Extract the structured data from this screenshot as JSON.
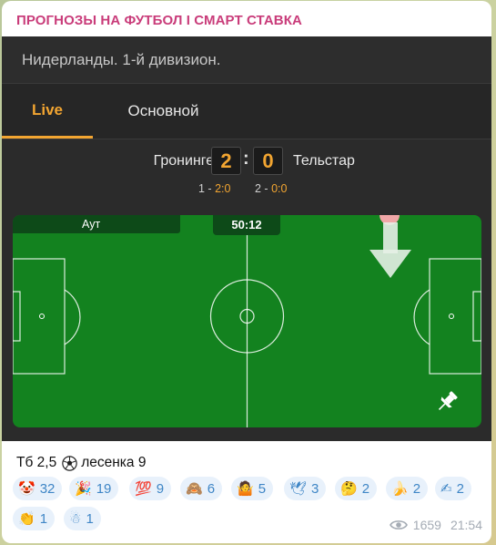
{
  "channel": {
    "title": "ПРОГНОЗЫ НА ФУТБОЛ І СМАРТ СТАВКА"
  },
  "widget": {
    "league": "Нидерланды. 1-й дивизион.",
    "tabs": [
      {
        "label": "Live",
        "active": true
      },
      {
        "label": "Основной",
        "active": false
      }
    ],
    "match": {
      "home_team": "Гронинген",
      "away_team": "Тельстар",
      "home_score": "2",
      "away_score": "0",
      "separator": ":",
      "period1_prefix": "1 - ",
      "period1_score": "2:0",
      "period2_prefix": "2 - ",
      "period2_score": "0:0"
    },
    "field": {
      "event": "Аут",
      "timer": "50:12",
      "icons": [
        "down-arrow-icon",
        "pin-icon"
      ]
    },
    "colors": {
      "accent": "#f2a531",
      "pitch": "#13821f",
      "panel": "#2b2b2b"
    }
  },
  "post": {
    "text_before": "Тб 2,5",
    "ball_icon": "soccer-ball-icon",
    "text_after": "лесенка 9"
  },
  "reactions": [
    {
      "emoji": "🤡",
      "count": "32"
    },
    {
      "emoji": "🎉",
      "count": "19"
    },
    {
      "emoji": "💯",
      "count": "9"
    },
    {
      "emoji": "🙈",
      "count": "6"
    },
    {
      "emoji": "🤷",
      "count": "5"
    },
    {
      "emoji": "🕊",
      "count": "3"
    },
    {
      "emoji": "🤔",
      "count": "2"
    },
    {
      "emoji": "🍌",
      "count": "2"
    },
    {
      "emoji": "✍",
      "count": "2"
    },
    {
      "emoji": "👏",
      "count": "1"
    },
    {
      "emoji": "☃",
      "count": "1"
    }
  ],
  "meta": {
    "views": "1659",
    "time": "21:54",
    "views_icon": "eye-icon"
  }
}
